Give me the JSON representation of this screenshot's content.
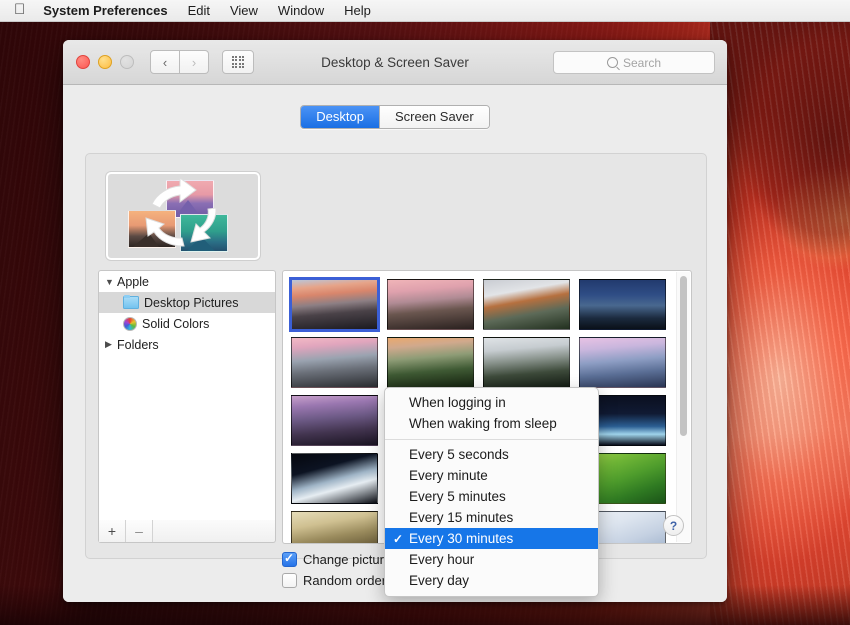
{
  "menubar": {
    "apple_icon": "apple-logo",
    "items": [
      {
        "label": "System Preferences",
        "bold": true
      },
      {
        "label": "Edit",
        "bold": false
      },
      {
        "label": "View",
        "bold": false
      },
      {
        "label": "Window",
        "bold": false
      },
      {
        "label": "Help",
        "bold": false
      }
    ]
  },
  "window": {
    "title": "Desktop & Screen Saver",
    "traffic_lights": {
      "close": "close-button",
      "minimize": "minimize-button",
      "zoom": "zoom-button-disabled"
    },
    "nav": {
      "back_icon": "‹",
      "forward_icon": "›",
      "grid_icon": "show-all-grid-icon"
    },
    "search": {
      "placeholder": "Search",
      "value": "",
      "icon": "search-icon"
    }
  },
  "tabs": [
    {
      "label": "Desktop",
      "active": true
    },
    {
      "label": "Screen Saver",
      "active": false
    }
  ],
  "sidebar": {
    "items": [
      {
        "label": "Apple",
        "disclosure": "▼",
        "level": 0,
        "icon": "none",
        "selected": false
      },
      {
        "label": "Desktop Pictures",
        "disclosure": "",
        "level": 1,
        "icon": "folder-icon",
        "selected": true
      },
      {
        "label": "Solid Colors",
        "disclosure": "",
        "level": 1,
        "icon": "color-wheel-icon",
        "selected": false
      },
      {
        "label": "Folders",
        "disclosure": "▶",
        "level": 0,
        "icon": "none",
        "selected": false
      }
    ],
    "footer": {
      "add_label": "+",
      "remove_label": "–"
    }
  },
  "thumbnails": {
    "selected_index": 0,
    "items": [
      {
        "name": "el-capitan-dawn",
        "gradient": "linear-gradient(175deg,#b9c6da 0%,#e6a489 16%,#d9866c 30%,#8d7f84 48%,#4a4248 66%,#1b1a20 100%)"
      },
      {
        "name": "yosemite-sunset",
        "gradient": "linear-gradient(175deg,#f0b4b8 0%,#dfa1ad 22%,#b08b94 42%,#6a564f 62%,#2a211f 100%)"
      },
      {
        "name": "el-capitan-clouds",
        "gradient": "linear-gradient(170deg,#c9ccd2 0%,#e2e4e7 26%,#b6703f 44%,#5d6a58 66%,#22301f 100%)"
      },
      {
        "name": "half-dome-night",
        "gradient": "linear-gradient(180deg,#223a6e 0%,#2f4d85 30%,#49688f 52%,#1b2a3e 78%,#0a1018 100%)"
      },
      {
        "name": "half-dome-pink",
        "gradient": "linear-gradient(175deg,#f3b9c5 0%,#e0a5bd 18%,#9aa3b0 42%,#6a6f78 64%,#2a2c30 100%)"
      },
      {
        "name": "yosemite-valley-green",
        "gradient": "linear-gradient(175deg,#e9a96f 0%,#d0a98d 18%,#8e9c76 40%,#3f5a34 66%,#15220f 100%)"
      },
      {
        "name": "half-dome-monochrome",
        "gradient": "linear-gradient(175deg,#dfe3e6 0%,#c6ccd0 24%,#87918a 46%,#3d4a3a 70%,#141c14 100%)"
      },
      {
        "name": "half-dome-lavender",
        "gradient": "linear-gradient(175deg,#e7c2e4 0%,#c9b6dd 22%,#8e9ec4 46%,#5a6e95 70%,#2a3553 100%)"
      },
      {
        "name": "lake-stones-purple",
        "gradient": "linear-gradient(175deg,#c8a0cb 0%,#9a77b0 20%,#6d5a86 44%,#42344f 70%,#1a1422 100%)"
      },
      {
        "name": "mavericks-wave",
        "gradient": "linear-gradient(160deg,#2f8f7a 0%,#2fa98e 22%,#2a7f8e 46%,#215d80 70%,#13354f 100%)"
      },
      {
        "name": "wave-beach",
        "gradient": "linear-gradient(170deg,#f0d6b4 0%,#e7cfae 22%,#7fb4cc 46%,#3d86b4 70%,#1f5f92 100%)"
      },
      {
        "name": "earth-horizon-moon",
        "gradient": "linear-gradient(180deg,#0b1020 0%,#101a33 36%,#2b5e93 62%,#9fd3ea 78%,#0a0f1c 100%)"
      },
      {
        "name": "earth-glacier",
        "gradient": "linear-gradient(165deg,#05070e 0%,#0c1322 30%,#9fb4c6 52%,#e6edf2 66%,#0a0d14 100%)"
      },
      {
        "name": "earth-ocean-swirl",
        "gradient": "linear-gradient(160deg,#07101c 0%,#0d2136 34%,#2f6f8f 56%,#cfe3ec 72%,#0a1420 100%)"
      },
      {
        "name": "earth-blue-marble",
        "gradient": "linear-gradient(170deg,#061018 0%,#0a2030 34%,#2a7aa8 58%,#b9dce9 76%,#050a10 100%)"
      },
      {
        "name": "green-fields",
        "gradient": "linear-gradient(160deg,#9fd24a 0%,#6fb536 26%,#4e9c2c 50%,#2f7a22 74%,#1b5418 100%)"
      },
      {
        "name": "desert-dunes",
        "gradient": "linear-gradient(170deg,#e5dcb8 0%,#cfc091 26%,#9a8b5d 50%,#6b5e3a 74%,#3d3520 100%)"
      },
      {
        "name": "ice-blue-abstract",
        "gradient": "linear-gradient(165deg,#dfe6ef 0%,#cfd9e6 28%,#aebdd2 54%,#8fa2bd 76%,#6d82a2 100%)"
      },
      {
        "name": "soft-clouds-white",
        "gradient": "linear-gradient(170deg,#f3f5f9 0%,#e2e8f1 28%,#cdd7e5 54%,#b5c3d6 78%,#9dadc5 100%)"
      },
      {
        "name": "cloud-folds",
        "gradient": "linear-gradient(160deg,#eef2f7 0%,#dde5ef 30%,#c5d1e2 58%,#aabbd2 80%,#92a6c2 100%)"
      }
    ]
  },
  "controls": {
    "change_picture": {
      "label": "Change picture:",
      "checked": true
    },
    "random_order": {
      "label": "Random order",
      "checked": false
    },
    "interval_popup": {
      "value": "Every 30 minutes"
    },
    "help": {
      "label": "?"
    }
  },
  "dropdown": {
    "items": [
      {
        "label": "When logging in",
        "checked": false,
        "highlighted": false
      },
      {
        "label": "When waking from sleep",
        "checked": false,
        "highlighted": false
      },
      {
        "separator": true
      },
      {
        "label": "Every 5 seconds",
        "checked": false,
        "highlighted": false
      },
      {
        "label": "Every minute",
        "checked": false,
        "highlighted": false
      },
      {
        "label": "Every 5 minutes",
        "checked": false,
        "highlighted": false
      },
      {
        "label": "Every 15 minutes",
        "checked": false,
        "highlighted": false
      },
      {
        "label": "Every 30 minutes",
        "checked": true,
        "highlighted": true
      },
      {
        "label": "Every hour",
        "checked": false,
        "highlighted": false
      },
      {
        "label": "Every day",
        "checked": false,
        "highlighted": false
      }
    ],
    "check_glyph": "✓"
  },
  "colors": {
    "accent_blue": "#1676e8",
    "tab_active_blue": "#2673e8",
    "selection_border": "#3b5fd6",
    "wallpaper_red": "#e8553a"
  }
}
